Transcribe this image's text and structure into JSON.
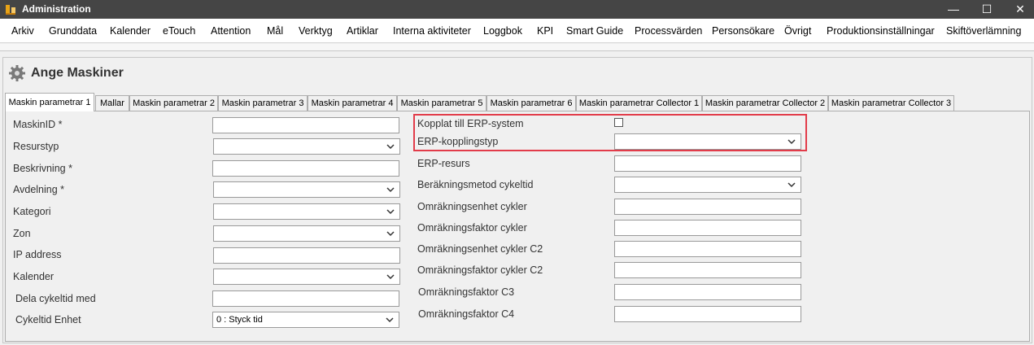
{
  "window": {
    "title": "Administration"
  },
  "menu": [
    "Arkiv",
    "Grunddata",
    "Kalender",
    "eTouch",
    "Attention",
    "Mål",
    "Verktyg",
    "Artiklar",
    "Interna aktiviteter",
    "Loggbok",
    "KPI",
    "Smart Guide",
    "Processvärden",
    "Personsökare",
    "Övrigt",
    "Produktionsinställningar",
    "Skiftöverlämning"
  ],
  "page": {
    "title": "Ange Maskiner"
  },
  "tabs": [
    "Maskin parametrar 1",
    "Mallar",
    "Maskin parametrar 2",
    "Maskin parametrar 3",
    "Maskin parametrar 4",
    "Maskin parametrar 5",
    "Maskin parametrar 6",
    "Maskin parametrar Collector 1",
    "Maskin parametrar Collector 2",
    "Maskin parametrar Collector 3"
  ],
  "active_tab": "Maskin parametrar 1",
  "left_fields": [
    {
      "label": "MaskinID *",
      "type": "text",
      "value": ""
    },
    {
      "label": "Resurstyp",
      "type": "select",
      "value": ""
    },
    {
      "label": "Beskrivning *",
      "type": "text",
      "value": ""
    },
    {
      "label": "Avdelning *",
      "type": "select",
      "value": ""
    },
    {
      "label": "Kategori",
      "type": "select",
      "value": ""
    },
    {
      "label": "Zon",
      "type": "select",
      "value": ""
    },
    {
      "label": "IP address",
      "type": "text",
      "value": ""
    },
    {
      "label": "Kalender",
      "type": "select",
      "value": ""
    },
    {
      "label": "Dela cykeltid med",
      "type": "text",
      "value": ""
    },
    {
      "label": "Cykeltid Enhet",
      "type": "select",
      "value": "0 : Styck tid"
    }
  ],
  "right_fields": [
    {
      "label": "Kopplat till ERP-system",
      "type": "checkbox",
      "checked": false
    },
    {
      "label": "ERP-kopplingstyp",
      "type": "select",
      "value": ""
    },
    {
      "label": "ERP-resurs",
      "type": "text",
      "value": ""
    },
    {
      "label": "Beräkningsmetod cykeltid",
      "type": "select",
      "value": ""
    },
    {
      "label": "Omräkningsenhet cykler",
      "type": "text",
      "value": ""
    },
    {
      "label": "Omräkningsfaktor cykler",
      "type": "text",
      "value": ""
    },
    {
      "label": "Omräkningsenhet cykler C2",
      "type": "text",
      "value": ""
    },
    {
      "label": "Omräkningsfaktor cykler C2",
      "type": "text",
      "value": ""
    },
    {
      "label": "Omräkningsfaktor C3",
      "type": "text",
      "value": ""
    },
    {
      "label": "Omräkningsfaktor C4",
      "type": "text",
      "value": ""
    }
  ],
  "colors": {
    "titlebar": "#454545",
    "highlight": "#e23c4a",
    "accent_orange": "#e8a317"
  },
  "icons": {
    "app": "app-logo-icon",
    "header": "gear-icon",
    "select": "chevron-down-icon"
  }
}
